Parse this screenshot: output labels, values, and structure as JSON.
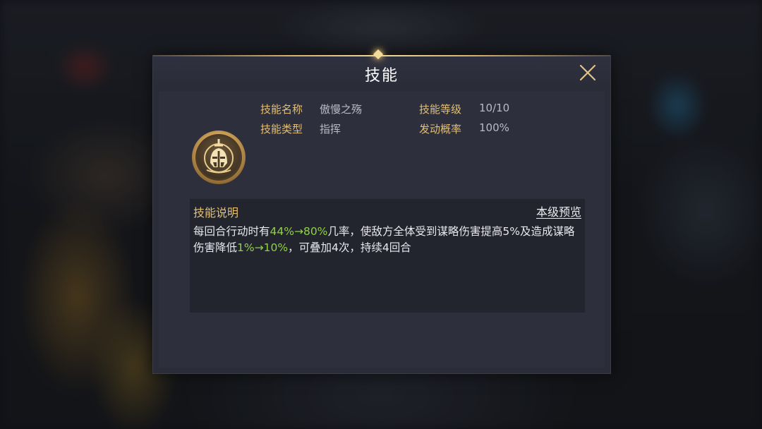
{
  "dialog": {
    "title": "技能",
    "close_icon": "close-x-icon"
  },
  "skill": {
    "icon": "knight-helmet-icon",
    "name_label": "技能名称",
    "name_value": "傲慢之殇",
    "level_label": "技能等级",
    "level_value": "10/10",
    "type_label": "技能类型",
    "type_value": "指挥",
    "chance_label": "发动概率",
    "chance_value": "100%"
  },
  "description": {
    "title": "技能说明",
    "preview_link": "本级预览",
    "segments": [
      {
        "text": "每回合行动时有",
        "highlight": false
      },
      {
        "text": "44%→80%",
        "highlight": true
      },
      {
        "text": "几率，使敌方全体受到谋略伤害提高5%及造成谋略伤害降低",
        "highlight": false
      },
      {
        "text": "1%→10%",
        "highlight": true
      },
      {
        "text": "，可叠加4次，持续4回合",
        "highlight": false
      }
    ]
  },
  "colors": {
    "label_gold": "#e3bf73",
    "highlight_green": "#8fd341",
    "panel_bg": "#2a2c38"
  }
}
